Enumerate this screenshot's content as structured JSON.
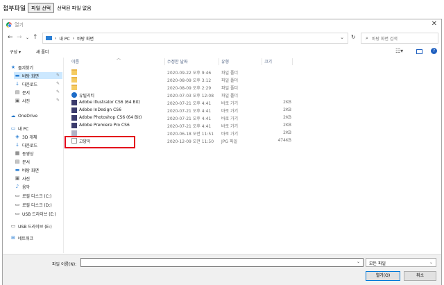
{
  "page": {
    "attachment_label": "첨부파일",
    "choose_file_button": "파일 선택",
    "no_file_text": "선택된 파일 없음"
  },
  "dialog": {
    "title": "열기",
    "close_glyph": "✕",
    "address": {
      "segments": [
        "›",
        "내 PC",
        "›",
        "바탕 화면"
      ]
    },
    "search_placeholder": "바탕 화면 검색",
    "toolbar": {
      "organize": "구성 ▾",
      "new_folder": "새 폴더"
    },
    "sidebar": {
      "items": [
        {
          "label": "즐겨찾기",
          "icon": "star-icon"
        },
        {
          "label": "바탕 화면",
          "icon": "desktop-icon"
        },
        {
          "label": "다운로드",
          "icon": "download-icon"
        },
        {
          "label": "문서",
          "icon": "document-icon"
        },
        {
          "label": "사진",
          "icon": "picture-icon"
        },
        {
          "label": "OneDrive",
          "icon": "cloud-icon"
        },
        {
          "label": "내 PC",
          "icon": "computer-icon"
        },
        {
          "label": "3D 개체",
          "icon": "cube-icon"
        },
        {
          "label": "다운로드",
          "icon": "download-icon"
        },
        {
          "label": "동영상",
          "icon": "video-icon"
        },
        {
          "label": "문서",
          "icon": "document-icon"
        },
        {
          "label": "바탕 화면",
          "icon": "desktop-icon"
        },
        {
          "label": "사진",
          "icon": "picture-icon"
        },
        {
          "label": "음악",
          "icon": "music-icon"
        },
        {
          "label": "로컬 디스크 (C:)",
          "icon": "drive-icon"
        },
        {
          "label": "로컬 디스크 (D:)",
          "icon": "drive-icon"
        },
        {
          "label": "USB 드라이브 (E:)",
          "icon": "usb-drive-icon"
        },
        {
          "label": "USB 드라이브 (E:)",
          "icon": "usb-drive-icon"
        },
        {
          "label": "네트워크",
          "icon": "network-icon"
        }
      ]
    },
    "columns": {
      "name": "이름",
      "modified": "수정한 날짜",
      "type": "유형",
      "size": "크기"
    },
    "files": [
      {
        "name": "",
        "modified": "2020-09-22 오후 9:46",
        "type": "파일 폴더",
        "size": "",
        "icon": "folder-icon"
      },
      {
        "name": "",
        "modified": "2020-08-09 오후 3:12",
        "type": "파일 폴더",
        "size": "",
        "icon": "folder-icon"
      },
      {
        "name": "",
        "modified": "2020-08-09 오후 2:29",
        "type": "파일 폴더",
        "size": "",
        "icon": "folder-icon"
      },
      {
        "name": "유틸리티",
        "modified": "2020-07-03 오후 12:08",
        "type": "파일 폴더",
        "size": "",
        "icon": "utility-icon"
      },
      {
        "name": "Adobe Illustrator CS6 (64 Bit)",
        "modified": "2020-07-21 오후 4:41",
        "type": "바로 가기",
        "size": "2KB",
        "icon": "shortcut-icon"
      },
      {
        "name": "Adobe InDesign CS6",
        "modified": "2020-07-21 오후 4:41",
        "type": "바로 가기",
        "size": "2KB",
        "icon": "shortcut-icon"
      },
      {
        "name": "Adobe Photoshop CS6 (64 Bit)",
        "modified": "2020-07-21 오후 4:41",
        "type": "바로 가기",
        "size": "2KB",
        "icon": "shortcut-icon"
      },
      {
        "name": "Adobe Premiere Pro CS6",
        "modified": "2020-07-21 오후 4:41",
        "type": "바로 가기",
        "size": "2KB",
        "icon": "shortcut-icon"
      },
      {
        "name": "",
        "modified": "2020-06-18 오전 11:51",
        "type": "바로 가기",
        "size": "2KB",
        "icon": "shortcut-icon"
      },
      {
        "name": "고양이",
        "modified": "2020-12-09 오전 11:50",
        "type": "JPG 파일",
        "size": "474KB",
        "icon": "jpg-file-icon"
      }
    ],
    "filename_label": "파일 이름(N):",
    "filename_value": "",
    "filetype_value": "모든 파일",
    "open_button": "열기(O)",
    "cancel_button": "취소"
  }
}
